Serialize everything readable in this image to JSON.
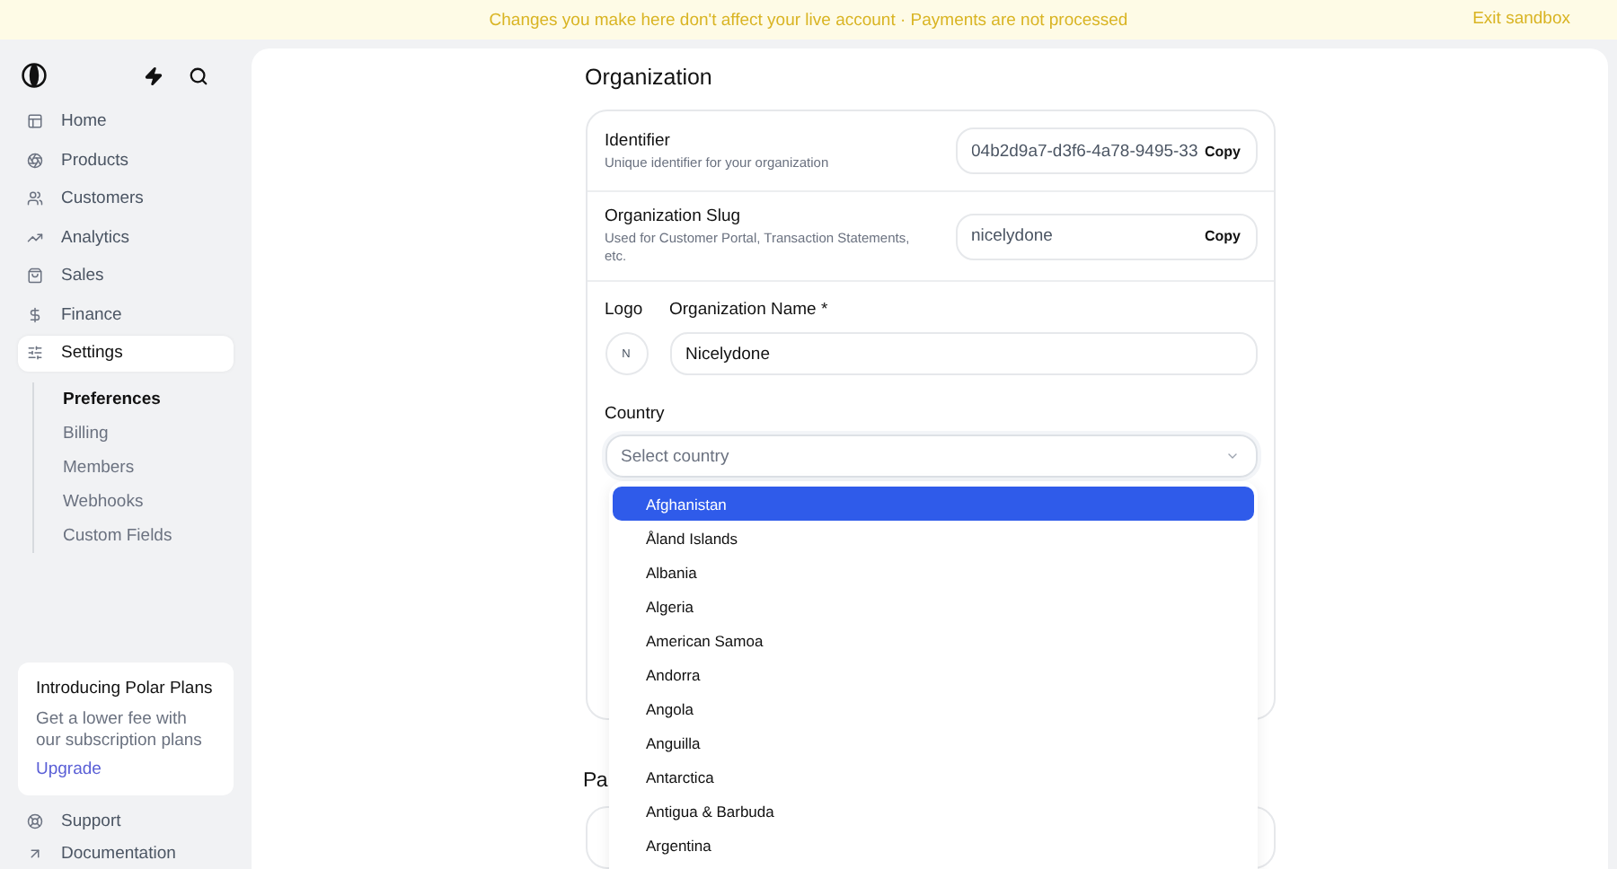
{
  "banner": {
    "message": "Changes you make here don't affect your live account · Payments are not processed",
    "action": "Exit sandbox"
  },
  "sidebar": {
    "nav": [
      {
        "label": "Home",
        "selected": false
      },
      {
        "label": "Products",
        "selected": false
      },
      {
        "label": "Customers",
        "selected": false
      },
      {
        "label": "Analytics",
        "selected": false
      },
      {
        "label": "Sales",
        "selected": false
      },
      {
        "label": "Finance",
        "selected": false
      },
      {
        "label": "Settings",
        "selected": true
      }
    ],
    "sub_items": [
      {
        "label": "Preferences",
        "selected": true
      },
      {
        "label": "Billing",
        "selected": false
      },
      {
        "label": "Members",
        "selected": false
      },
      {
        "label": "Webhooks",
        "selected": false
      },
      {
        "label": "Custom Fields",
        "selected": false
      }
    ],
    "promo": {
      "title": "Introducing Polar Plans",
      "text": "Get a lower fee with our subscription plans",
      "link": "Upgrade"
    },
    "footer_links": [
      "Support",
      "Documentation"
    ]
  },
  "organization": {
    "heading": "Organization",
    "identifier": {
      "label": "Identifier",
      "hint": "Unique identifier for your organization",
      "value": "04b2d9a7-d3f6-4a78-9495-33",
      "button": "Copy"
    },
    "slug": {
      "label": "Organization Slug",
      "hint": "Used for Customer Portal, Transaction Statements, etc.",
      "value": "nicelydone",
      "button": "Copy"
    },
    "logo": {
      "label": "Logo",
      "initial": "N"
    },
    "name": {
      "label": "Organization Name *",
      "value": "Nicelydone"
    },
    "country": {
      "label": "Country",
      "placeholder": "Select country",
      "expanded": true,
      "options": [
        {
          "label": "Afghanistan",
          "selected": true
        },
        {
          "label": "Åland Islands",
          "selected": false
        },
        {
          "label": "Albania",
          "selected": false
        },
        {
          "label": "Algeria",
          "selected": false
        },
        {
          "label": "American Samoa",
          "selected": false
        },
        {
          "label": "Andorra",
          "selected": false
        },
        {
          "label": "Angola",
          "selected": false
        },
        {
          "label": "Anguilla",
          "selected": false
        },
        {
          "label": "Antarctica",
          "selected": false
        },
        {
          "label": "Antigua & Barbuda",
          "selected": false
        },
        {
          "label": "Argentina",
          "selected": false
        }
      ]
    }
  },
  "next_section": {
    "heading": "Pa"
  }
}
